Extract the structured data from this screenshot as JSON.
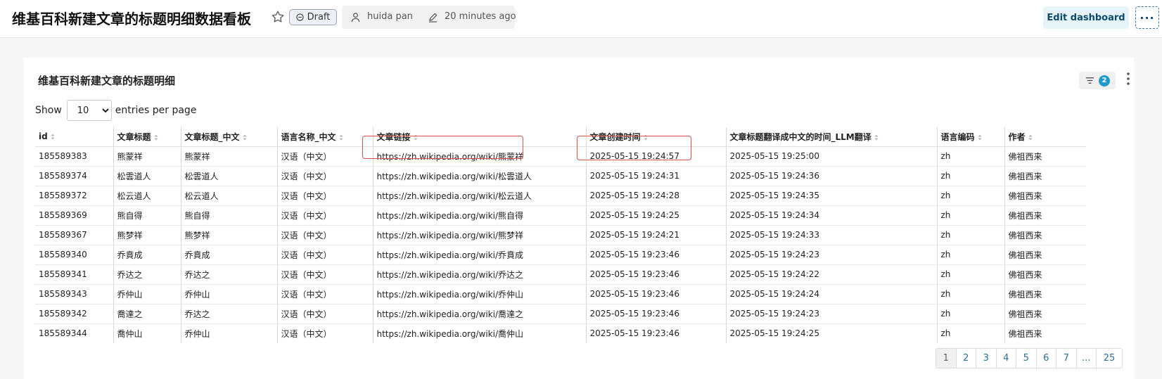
{
  "header": {
    "title": "维基百科新建文章的标题明细数据看板",
    "status": "Draft",
    "author": "huida pan",
    "edited": "20 minutes ago",
    "edit_button": "Edit dashboard",
    "more_button": "···"
  },
  "card": {
    "title": "维基百科新建文章的标题明细",
    "filter_count": "2",
    "show_label": "Show",
    "page_size": "10",
    "entries_label": "entries per page"
  },
  "table": {
    "columns": [
      "id",
      "文章标题",
      "文章标题_中文",
      "语言名称_中文",
      "文章链接",
      "文章创建时间",
      "文章标题翻译成中文的时间_LLM翻译",
      "语言编码",
      "作者"
    ],
    "rows": [
      [
        "185589383",
        "熊蒙祥",
        "熊蒙祥",
        "汉语（中文）",
        "https://zh.wikipedia.org/wiki/熊蒙祥",
        "2025-05-15 19:24:57",
        "2025-05-15 19:25:00",
        "zh",
        "佛祖西来"
      ],
      [
        "185589374",
        "松雲道人",
        "松雲道人",
        "汉语（中文）",
        "https://zh.wikipedia.org/wiki/松雲道人",
        "2025-05-15 19:24:31",
        "2025-05-15 19:24:36",
        "zh",
        "佛祖西来"
      ],
      [
        "185589372",
        "松云道人",
        "松云道人",
        "汉语（中文）",
        "https://zh.wikipedia.org/wiki/松云道人",
        "2025-05-15 19:24:28",
        "2025-05-15 19:24:35",
        "zh",
        "佛祖西来"
      ],
      [
        "185589369",
        "熊自得",
        "熊自得",
        "汉语（中文）",
        "https://zh.wikipedia.org/wiki/熊自得",
        "2025-05-15 19:24:25",
        "2025-05-15 19:24:34",
        "zh",
        "佛祖西来"
      ],
      [
        "185589367",
        "熊梦祥",
        "熊梦祥",
        "汉语（中文）",
        "https://zh.wikipedia.org/wiki/熊梦祥",
        "2025-05-15 19:24:21",
        "2025-05-15 19:24:33",
        "zh",
        "佛祖西来"
      ],
      [
        "185589340",
        "乔賁成",
        "乔賁成",
        "汉语（中文）",
        "https://zh.wikipedia.org/wiki/乔賁成",
        "2025-05-15 19:23:46",
        "2025-05-15 19:24:23",
        "zh",
        "佛祖西来"
      ],
      [
        "185589341",
        "乔达之",
        "乔达之",
        "汉语（中文）",
        "https://zh.wikipedia.org/wiki/乔达之",
        "2025-05-15 19:23:46",
        "2025-05-15 19:24:22",
        "zh",
        "佛祖西来"
      ],
      [
        "185589343",
        "乔仲山",
        "乔仲山",
        "汉语（中文）",
        "https://zh.wikipedia.org/wiki/乔仲山",
        "2025-05-15 19:23:46",
        "2025-05-15 19:24:24",
        "zh",
        "佛祖西来"
      ],
      [
        "185589342",
        "喬達之",
        "乔达之",
        "汉语（中文）",
        "https://zh.wikipedia.org/wiki/喬達之",
        "2025-05-15 19:23:46",
        "2025-05-15 19:24:23",
        "zh",
        "佛祖西来"
      ],
      [
        "185589344",
        "喬仲山",
        "乔仲山",
        "汉语（中文）",
        "https://zh.wikipedia.org/wiki/喬仲山",
        "2025-05-15 19:23:46",
        "2025-05-15 19:24:25",
        "zh",
        "佛祖西来"
      ]
    ]
  },
  "pagination": {
    "pages": [
      "1",
      "2",
      "3",
      "4",
      "5",
      "6",
      "7",
      "...",
      "25"
    ],
    "active": "1"
  },
  "colors": {
    "accent": "#1e9bc9",
    "highlight": "#e05151",
    "edit_button_bg": "#e6f3f7"
  },
  "icons": {
    "favorite": "star-icon",
    "status": "minus-circle-icon",
    "author": "user-icon",
    "edited": "pencil-icon",
    "filter": "filter-icon",
    "menu": "vertical-dots-icon",
    "sort": "sort-icon"
  }
}
